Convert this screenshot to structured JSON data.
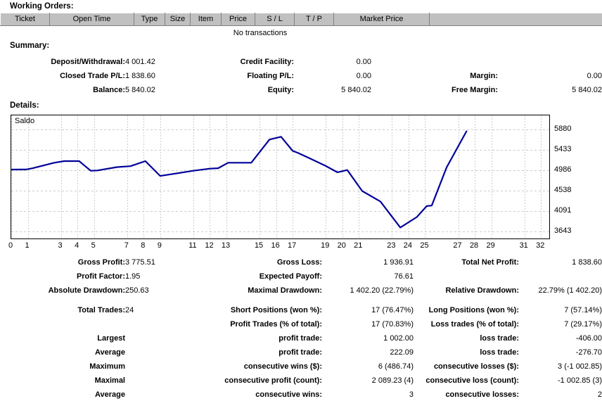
{
  "working_orders": {
    "title": "Working Orders:",
    "columns": [
      "Ticket",
      "Open Time",
      "Type",
      "Size",
      "Item",
      "Price",
      "S / L",
      "T / P",
      "Market Price",
      ""
    ],
    "empty_message": "No transactions"
  },
  "summary": {
    "title": "Summary:",
    "rows": [
      [
        {
          "label": "Deposit/Withdrawal:",
          "value": "4 001.42"
        },
        {
          "label": "Credit Facility:",
          "value": "0.00"
        },
        {
          "label": "",
          "value": ""
        }
      ],
      [
        {
          "label": "Closed Trade P/L:",
          "value": "1 838.60"
        },
        {
          "label": "Floating P/L:",
          "value": "0.00"
        },
        {
          "label": "Margin:",
          "value": "0.00"
        }
      ],
      [
        {
          "label": "Balance:",
          "value": "5 840.02"
        },
        {
          "label": "Equity:",
          "value": "5 840.02"
        },
        {
          "label": "Free Margin:",
          "value": "5 840.02"
        }
      ]
    ]
  },
  "details": {
    "title": "Details:"
  },
  "chart_data": {
    "type": "line",
    "title": "Saldo",
    "series_name": "Saldo",
    "line_color": "#000099",
    "grid": true,
    "legend": "none",
    "xlabel": "",
    "ylabel": "",
    "ylim": [
      3643,
      5880
    ],
    "yticks": [
      5880,
      5433,
      4986,
      4538,
      4091,
      3643
    ],
    "xticks": [
      0,
      1,
      3,
      4,
      5,
      7,
      8,
      9,
      11,
      12,
      13,
      15,
      16,
      17,
      19,
      20,
      21,
      23,
      24,
      25,
      27,
      28,
      29,
      31,
      32
    ],
    "xlim": [
      0,
      32.5
    ],
    "x": [
      0,
      1,
      2,
      3,
      4,
      5,
      6,
      7,
      8,
      9,
      10,
      11,
      12,
      13,
      14,
      15,
      16,
      17,
      18,
      19,
      20,
      21,
      22,
      23,
      24,
      25,
      26,
      27
    ],
    "values": [
      5000,
      5002,
      5080,
      5150,
      5185,
      5185,
      5055,
      5080,
      5100,
      5110,
      5185,
      4925,
      4985,
      5040,
      5070,
      5090,
      5155,
      5155,
      5570,
      5660,
      5660,
      5260,
      5140,
      5060,
      4950,
      4975,
      4840,
      4600,
      4390,
      4250,
      4090,
      3700,
      3950,
      4150,
      4230,
      5100,
      5840
    ],
    "points": [
      {
        "x": 0,
        "y": 5000
      },
      {
        "x": 0.9,
        "y": 5002
      },
      {
        "x": 1.3,
        "y": 5030
      },
      {
        "x": 2.6,
        "y": 5150
      },
      {
        "x": 3.2,
        "y": 5185
      },
      {
        "x": 4.1,
        "y": 5185
      },
      {
        "x": 4.8,
        "y": 4975
      },
      {
        "x": 5.2,
        "y": 4980
      },
      {
        "x": 6.4,
        "y": 5055
      },
      {
        "x": 7.2,
        "y": 5075
      },
      {
        "x": 8.1,
        "y": 5185
      },
      {
        "x": 9.0,
        "y": 4860
      },
      {
        "x": 11.0,
        "y": 4975
      },
      {
        "x": 12.0,
        "y": 5020
      },
      {
        "x": 12.5,
        "y": 5030
      },
      {
        "x": 13.1,
        "y": 5150
      },
      {
        "x": 14.5,
        "y": 5150
      },
      {
        "x": 15.6,
        "y": 5660
      },
      {
        "x": 16.3,
        "y": 5720
      },
      {
        "x": 17.0,
        "y": 5410
      },
      {
        "x": 17.3,
        "y": 5370
      },
      {
        "x": 18.0,
        "y": 5250
      },
      {
        "x": 19.0,
        "y": 5080
      },
      {
        "x": 19.7,
        "y": 4940
      },
      {
        "x": 20.3,
        "y": 4990
      },
      {
        "x": 21.2,
        "y": 4530
      },
      {
        "x": 22.3,
        "y": 4300
      },
      {
        "x": 23.5,
        "y": 3730
      },
      {
        "x": 24.5,
        "y": 3960
      },
      {
        "x": 25.1,
        "y": 4200
      },
      {
        "x": 25.4,
        "y": 4210
      },
      {
        "x": 26.3,
        "y": 5050
      },
      {
        "x": 27.5,
        "y": 5840
      }
    ]
  },
  "stats": {
    "block1": [
      [
        {
          "label": "Gross Profit:",
          "value": "3 775.51"
        },
        {
          "label": "Gross Loss:",
          "value": "1 936.91"
        },
        {
          "label": "Total Net Profit:",
          "value": "1 838.60"
        }
      ],
      [
        {
          "label": "Profit Factor:",
          "value": "1.95"
        },
        {
          "label": "Expected Payoff:",
          "value": "76.61"
        },
        {
          "label": "",
          "value": ""
        }
      ],
      [
        {
          "label": "Absolute Drawdown:",
          "value": "250.63"
        },
        {
          "label": "Maximal Drawdown:",
          "value": "1 402.20 (22.79%)"
        },
        {
          "label": "Relative Drawdown:",
          "value": "22.79% (1 402.20)"
        }
      ]
    ],
    "block2": [
      [
        {
          "label": "Total Trades:",
          "value": "24"
        },
        {
          "label": "Short Positions (won %):",
          "value": "17 (76.47%)"
        },
        {
          "label": "Long Positions (won %):",
          "value": "7 (57.14%)"
        }
      ],
      [
        {
          "label": "",
          "value": ""
        },
        {
          "label": "Profit Trades (% of total):",
          "value": "17 (70.83%)"
        },
        {
          "label": "Loss trades (% of total):",
          "value": "7 (29.17%)"
        }
      ],
      [
        {
          "label": "Largest",
          "value": ""
        },
        {
          "label": "profit trade:",
          "value": "1 002.00"
        },
        {
          "label": "loss trade:",
          "value": "-406.00"
        }
      ],
      [
        {
          "label": "Average",
          "value": ""
        },
        {
          "label": "profit trade:",
          "value": "222.09"
        },
        {
          "label": "loss trade:",
          "value": "-276.70"
        }
      ],
      [
        {
          "label": "Maximum",
          "value": ""
        },
        {
          "label": "consecutive wins ($):",
          "value": "6 (486.74)"
        },
        {
          "label": "consecutive losses ($):",
          "value": "3 (-1 002.85)"
        }
      ],
      [
        {
          "label": "Maximal",
          "value": ""
        },
        {
          "label": "consecutive profit (count):",
          "value": "2 089.23 (4)"
        },
        {
          "label": "consecutive loss (count):",
          "value": "-1 002.85 (3)"
        }
      ],
      [
        {
          "label": "Average",
          "value": ""
        },
        {
          "label": "consecutive wins:",
          "value": "3"
        },
        {
          "label": "consecutive losses:",
          "value": "2"
        }
      ]
    ]
  },
  "colors": {
    "header_gray": "#c0c0c0",
    "line_blue": "#000099",
    "grid": "#cccccc"
  }
}
